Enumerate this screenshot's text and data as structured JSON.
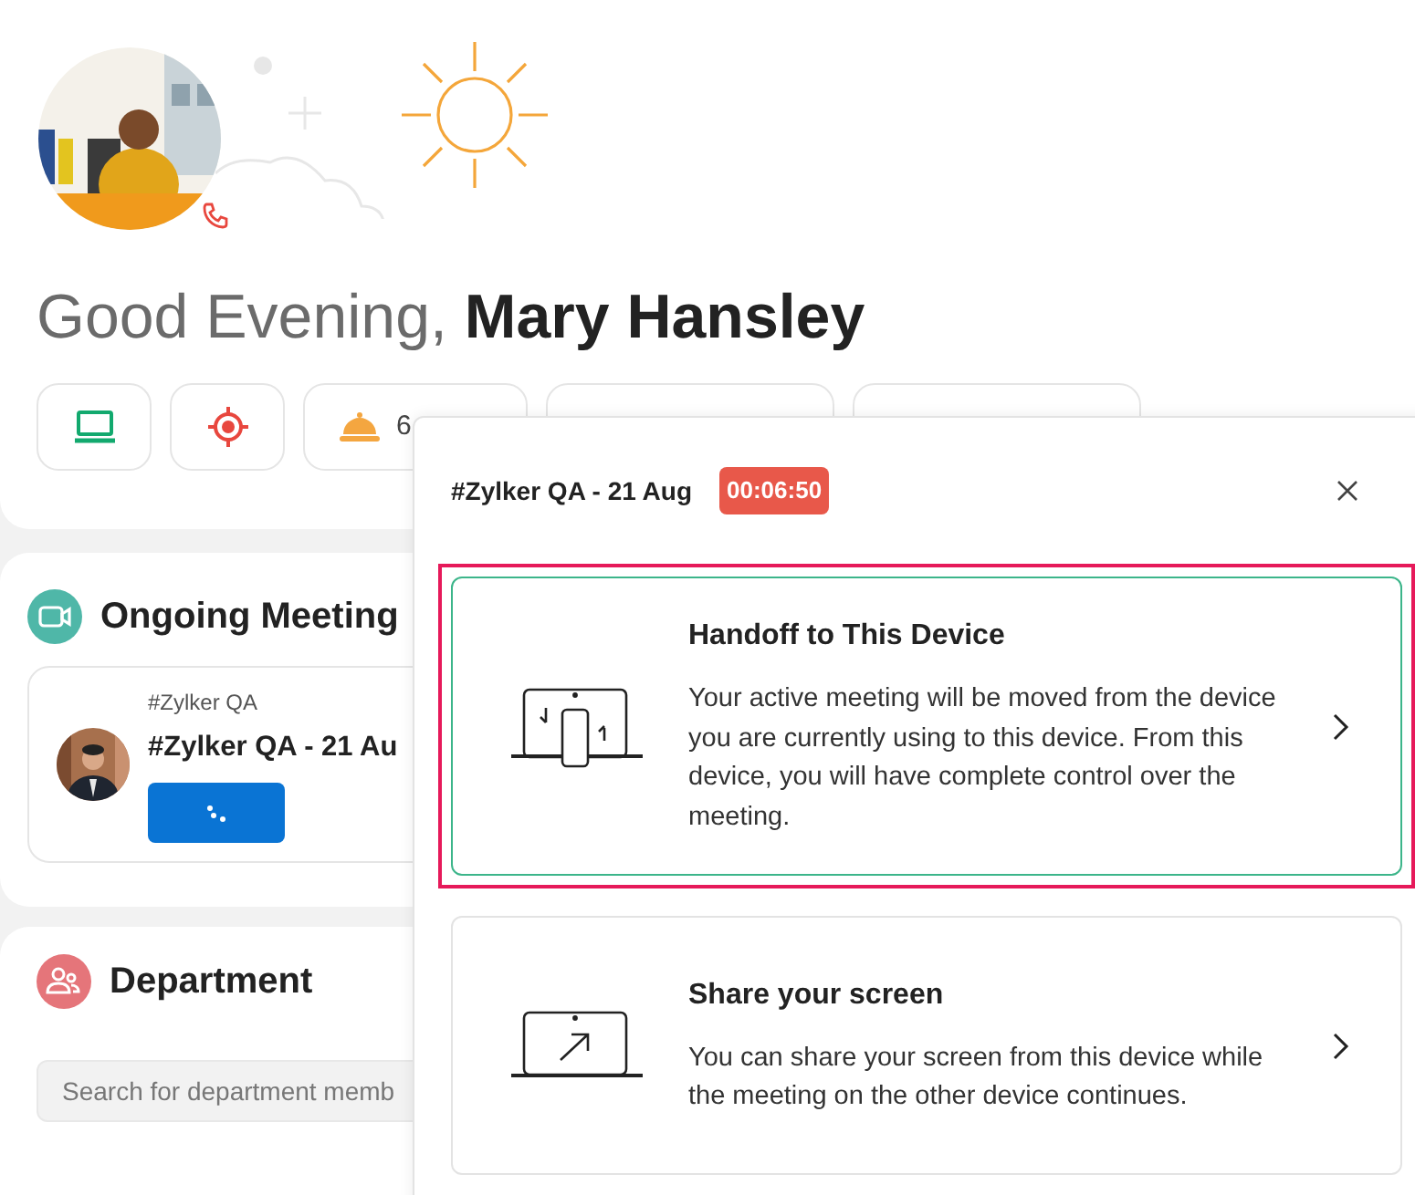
{
  "greeting": {
    "prefix": "Good Evening,",
    "name": "Mary Hansley"
  },
  "chips": [
    {
      "kind": "laptop"
    },
    {
      "kind": "target"
    },
    {
      "kind": "bell",
      "text": "6"
    },
    {
      "kind": "empty"
    },
    {
      "kind": "empty"
    }
  ],
  "ongoing": {
    "title": "Ongoing Meeting",
    "meeting": {
      "channel": "#Zylker QA",
      "title": "#Zylker QA - 21 Au"
    }
  },
  "department": {
    "title": "Department",
    "search": {
      "placeholder": "Search for department memb"
    }
  },
  "popup": {
    "title": "#Zylker QA - 21 Aug",
    "timer": "00:06:50",
    "options": [
      {
        "kind": "handoff",
        "title": "Handoff to This Device",
        "description": "Your active meeting will be moved from the device you are currently using to this device. From this device, you will have complete control over the meeting.",
        "selected": true
      },
      {
        "kind": "share",
        "title": "Share your screen",
        "description": "You can share your screen from this device while the meeting on the other device continues.",
        "selected": false
      }
    ]
  }
}
